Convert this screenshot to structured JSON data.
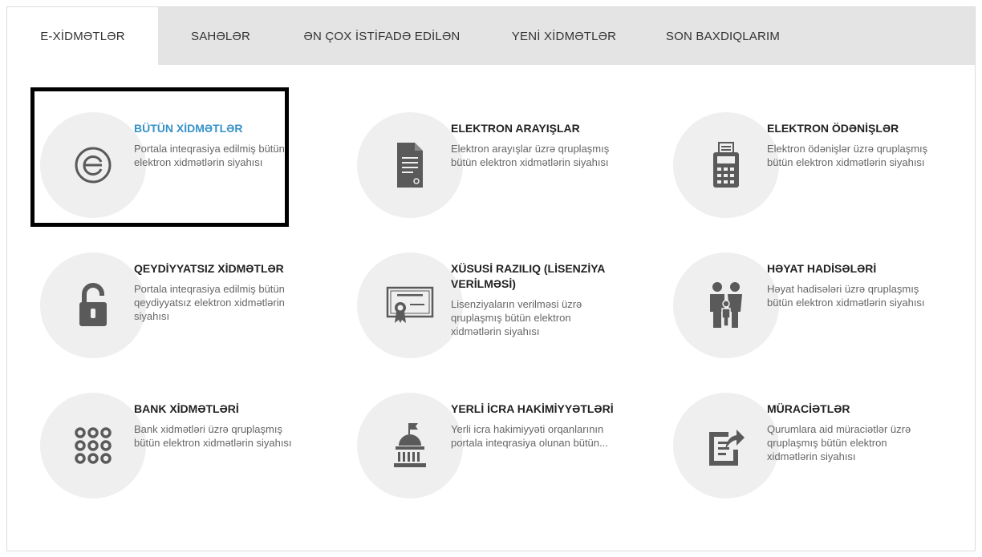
{
  "tabs": [
    {
      "label": "E-XİDMƏTLƏR",
      "active": true
    },
    {
      "label": "SAHƏLƏR",
      "active": false
    },
    {
      "label": "ƏN ÇOX İSTİFADƏ EDİLƏN",
      "active": false
    },
    {
      "label": "YENİ XİDMƏTLƏR",
      "active": false
    },
    {
      "label": "SON BAXDIQLARIM",
      "active": false
    }
  ],
  "cards": [
    {
      "title": "BÜTÜN XİDMƏTLƏR",
      "desc": "Portala inteqrasiya edilmiş bütün elektron xidmətlərin siyahısı",
      "icon": "e-gov-logo-icon"
    },
    {
      "title": "ELEKTRON ARAYIŞLAR",
      "desc": "Elektron arayışlar üzrə qruplaşmış bütün elektron xidmətlərin siyahısı",
      "icon": "document-icon"
    },
    {
      "title": "ELEKTRON ÖDƏNİŞLƏR",
      "desc": "Elektron ödənişlər üzrə qruplaşmış bütün elektron xidmətlərin siyahısı",
      "icon": "payment-terminal-icon"
    },
    {
      "title": "QEYDİYYATSIZ XİDMƏTLƏR",
      "desc": "Portala inteqrasiya edilmiş bütün qeydiyyatsız elektron xidmətlərin siyahısı",
      "icon": "unlock-icon"
    },
    {
      "title": "XÜSUSİ RAZILIQ (LİSENZİYA VERİLMƏSİ)",
      "desc": "Lisenziyaların verilməsi üzrə qruplaşmış bütün elektron xidmətlərin siyahısı",
      "icon": "certificate-icon"
    },
    {
      "title": "HƏYAT HADİSƏLƏRİ",
      "desc": "Həyat hadisələri üzrə qruplaşmış bütün elektron xidmətlərin siyahısı",
      "icon": "family-icon"
    },
    {
      "title": "BANK XİDMƏTLƏRİ",
      "desc": "Bank xidmətləri üzrə qruplaşmış bütün elektron xidmətlərin siyahısı",
      "icon": "keypad-icon"
    },
    {
      "title": "YERLİ İCRA HAKİMİYYƏTLƏRİ",
      "desc": "Yerli icra hakimiyyəti orqanlarının portala inteqrasiya olunan bütün...",
      "icon": "government-building-icon"
    },
    {
      "title": "MÜRACİƏTLƏR",
      "desc": "Qurumlara aid müraciətlər üzrə qruplaşmış bütün elektron xidmətlərin siyahısı",
      "icon": "appeal-document-icon"
    }
  ],
  "colors": {
    "accent": "#3792c8",
    "icon": "#5a5a5a",
    "circle": "#efefef"
  }
}
